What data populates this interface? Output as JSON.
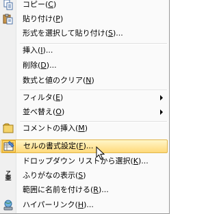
{
  "menu": {
    "items": [
      {
        "label": "コピー(",
        "mnemonic": "C",
        "tail": ")",
        "icon": "copy-icon"
      },
      {
        "label": "貼り付け(",
        "mnemonic": "P",
        "tail": ")",
        "icon": "paste-icon"
      },
      {
        "label": "形式を選択して貼り付け(",
        "mnemonic": "S",
        "tail": ")...",
        "icon": ""
      },
      {
        "label": "挿入(",
        "mnemonic": "I",
        "tail": ")...",
        "icon": ""
      },
      {
        "label": "削除(",
        "mnemonic": "D",
        "tail": ")...",
        "icon": ""
      },
      {
        "label": "数式と値のクリア(",
        "mnemonic": "N",
        "tail": ")",
        "icon": ""
      },
      {
        "label": "フィルタ(",
        "mnemonic": "E",
        "tail": ")",
        "icon": "",
        "submenu": true
      },
      {
        "label": "並べ替え(",
        "mnemonic": "O",
        "tail": ")",
        "icon": "",
        "submenu": true
      },
      {
        "label": "コメントの挿入(",
        "mnemonic": "M",
        "tail": ")",
        "icon": "comment-icon"
      },
      {
        "label": "セルの書式設定(",
        "mnemonic": "F",
        "tail": ")...",
        "icon": "format-cells-icon",
        "highlighted": true
      },
      {
        "label": "ドロップダウン リストから選択(",
        "mnemonic": "K",
        "tail": ")...",
        "icon": ""
      },
      {
        "label": "ふりがなの表示(",
        "mnemonic": "S",
        "tail": ")",
        "icon": "furigana-icon"
      },
      {
        "label": "範囲に名前を付ける(",
        "mnemonic": "R",
        "tail": ")...",
        "icon": ""
      },
      {
        "label": "ハイパーリンク(",
        "mnemonic": "H",
        "tail": ")...",
        "icon": "hyperlink-icon"
      }
    ],
    "furigana_glyph_top": "ア",
    "furigana_glyph_bottom": "亜"
  }
}
